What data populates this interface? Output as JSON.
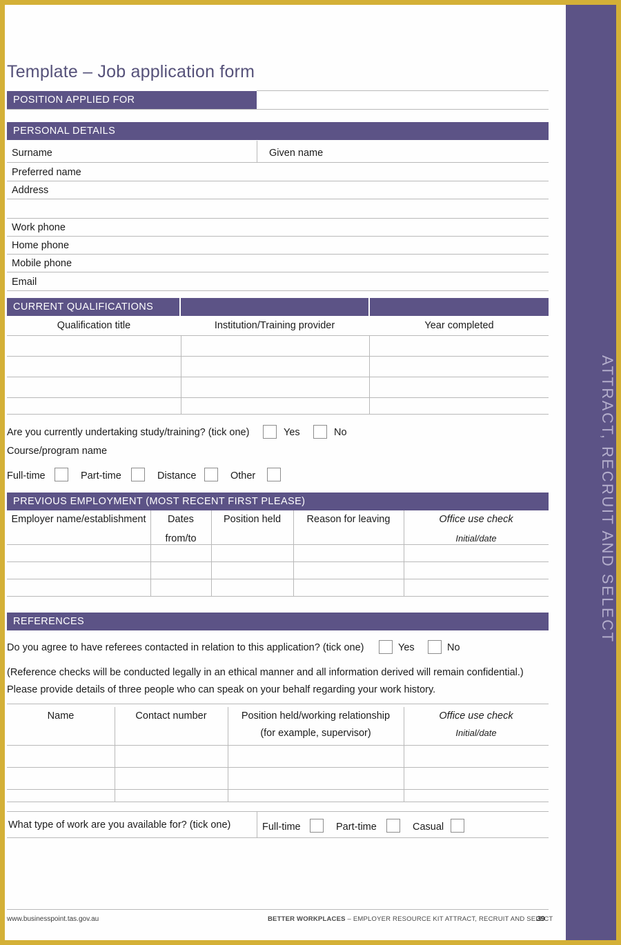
{
  "page": {
    "title": "Template – Job application form",
    "side_tab": "ATTRACT, RECRUIT AND SELECT",
    "accent_purple": "#5c5386",
    "accent_gold": "#d4b037",
    "title_color": "#56527a"
  },
  "position_applied": {
    "bar_label": "POSITION APPLIED FOR",
    "value": ""
  },
  "personal_details": {
    "bar_label": "PERSONAL DETAILS",
    "surname_label": "Surname",
    "given_name_label": "Given name",
    "preferred_name_label": "Preferred name",
    "address_label": "Address",
    "work_phone_label": "Work phone",
    "home_phone_label": "Home phone",
    "mobile_phone_label": "Mobile phone",
    "email_label": "Email"
  },
  "qualifications": {
    "bar_label": "CURRENT QUALIFICATIONS",
    "columns": [
      "Qualification title",
      "Institution/Training provider",
      "Year completed"
    ],
    "rows": [
      [
        "",
        "",
        ""
      ],
      [
        "",
        "",
        ""
      ],
      [
        "",
        "",
        ""
      ],
      [
        "",
        "",
        ""
      ]
    ]
  },
  "study": {
    "question": "Are you currently undertaking study/training? (tick one)",
    "yes_label": "Yes",
    "no_label": "No",
    "course_label": "Course/program name",
    "modes": [
      "Full-time",
      "Part-time",
      "Distance",
      "Other"
    ]
  },
  "previous_employment": {
    "bar_label": "PREVIOUS EMPLOYMENT (MOST RECENT FIRST PLEASE)",
    "columns": [
      "Employer name/establishment",
      "Dates\nfrom/to",
      "Position held",
      "Reason for leaving",
      "Office use check\nInitial/date"
    ],
    "col_dates_line1": "Dates",
    "col_dates_line2": "from/to",
    "col_office_line1": "Office use check",
    "col_office_line2": "Initial/date",
    "rows": [
      [
        "",
        "",
        "",
        "",
        ""
      ],
      [
        "",
        "",
        "",
        "",
        ""
      ],
      [
        "",
        "",
        "",
        "",
        ""
      ]
    ]
  },
  "references": {
    "bar_label": "REFERENCES",
    "agree_question": "Do you agree to have referees contacted in relation to this application? (tick one)",
    "yes_label": "Yes",
    "no_label": "No",
    "note_line1": "(Reference checks will be conducted legally in an ethical manner and all information derived will remain confidential.)",
    "note_line2": "Please provide details of three people who can speak on your behalf regarding your work history.",
    "columns": [
      "Name",
      "Contact number",
      "Position held/working relationship",
      "Office use check"
    ],
    "col_position_line1": "Position held/working relationship",
    "col_position_line2": "(for example, supervisor)",
    "col_office_line1": "Office use check",
    "col_office_line2": "Initial/date",
    "rows": [
      [
        "",
        "",
        "",
        ""
      ],
      [
        "",
        "",
        "",
        ""
      ],
      [
        "",
        "",
        "",
        ""
      ]
    ]
  },
  "availability": {
    "question": "What type of work are you available for? (tick one)",
    "options": [
      "Full-time",
      "Part-time",
      "Casual"
    ]
  },
  "footer": {
    "url": "www.businesspoint.tas.gov.au",
    "center_bold": "BETTER WORKPLACES",
    "center_rest": " – EMPLOYER RESOURCE KIT ATTRACT, RECRUIT AND SELECT",
    "page_number": "39"
  }
}
